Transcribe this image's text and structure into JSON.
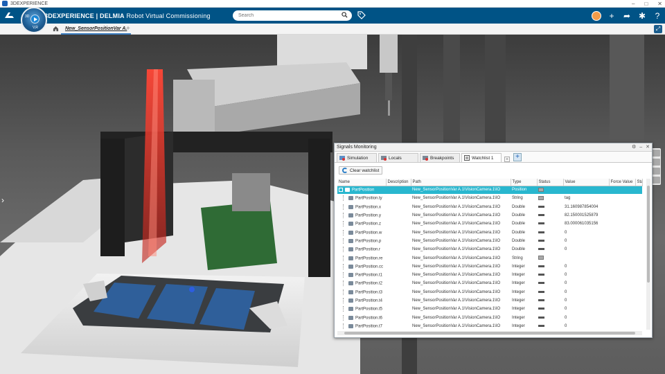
{
  "os_bar": {
    "title": "3DEXPERIENCE",
    "controls": [
      "–",
      "□",
      "✕"
    ]
  },
  "top_bar": {
    "brand_bold": "3DEXPERIENCE | DELMIA",
    "brand_rest": "Robot Virtual Commissioning",
    "search_placeholder": "Search"
  },
  "compass": {
    "top_label": "3D",
    "bottom_label": "V,R"
  },
  "tab_bar": {
    "document_tab": "New_SensorPositionVar A.",
    "add_tab": "+"
  },
  "panel": {
    "title": "Signals Monitoring",
    "tabs": [
      {
        "label": "Simulation"
      },
      {
        "label": "Locals"
      },
      {
        "label": "Breakpoints"
      },
      {
        "label": "Watchlist 1"
      }
    ],
    "clear_watchlist": "Clear watchlist",
    "columns": [
      "Name",
      "Description",
      "Path",
      "Type",
      "Status",
      "Value",
      "Force Value",
      "Sta"
    ],
    "rows": [
      {
        "name": "PartPosition",
        "path": "New_SensorPositionVar A.1\\VisionCamera.1\\IO",
        "type": "Position",
        "value": ""
      },
      {
        "name": "PartPosition.ty",
        "path": "New_SensorPositionVar A.1\\VisionCamera.1\\IO",
        "type": "String",
        "value": "tag"
      },
      {
        "name": "PartPosition.x",
        "path": "New_SensorPositionVar A.1\\VisionCamera.1\\IO",
        "type": "Double",
        "value": "31.160987854004"
      },
      {
        "name": "PartPosition.y",
        "path": "New_SensorPositionVar A.1\\VisionCamera.1\\IO",
        "type": "Double",
        "value": "82.150001525879"
      },
      {
        "name": "PartPosition.z",
        "path": "New_SensorPositionVar A.1\\VisionCamera.1\\IO",
        "type": "Double",
        "value": "83.000061035156"
      },
      {
        "name": "PartPosition.w",
        "path": "New_SensorPositionVar A.1\\VisionCamera.1\\IO",
        "type": "Double",
        "value": "0"
      },
      {
        "name": "PartPosition.p",
        "path": "New_SensorPositionVar A.1\\VisionCamera.1\\IO",
        "type": "Double",
        "value": "0"
      },
      {
        "name": "PartPosition.r",
        "path": "New_SensorPositionVar A.1\\VisionCamera.1\\IO",
        "type": "Double",
        "value": "0"
      },
      {
        "name": "PartPosition.re",
        "path": "New_SensorPositionVar A.1\\VisionCamera.1\\IO",
        "type": "String",
        "value": ""
      },
      {
        "name": "PartPosition.cc",
        "path": "New_SensorPositionVar A.1\\VisionCamera.1\\IO",
        "type": "Integer",
        "value": "0"
      },
      {
        "name": "PartPosition.t1",
        "path": "New_SensorPositionVar A.1\\VisionCamera.1\\IO",
        "type": "Integer",
        "value": "0"
      },
      {
        "name": "PartPosition.t2",
        "path": "New_SensorPositionVar A.1\\VisionCamera.1\\IO",
        "type": "Integer",
        "value": "0"
      },
      {
        "name": "PartPosition.t3",
        "path": "New_SensorPositionVar A.1\\VisionCamera.1\\IO",
        "type": "Integer",
        "value": "0"
      },
      {
        "name": "PartPosition.t4",
        "path": "New_SensorPositionVar A.1\\VisionCamera.1\\IO",
        "type": "Integer",
        "value": "0"
      },
      {
        "name": "PartPosition.t5",
        "path": "New_SensorPositionVar A.1\\VisionCamera.1\\IO",
        "type": "Integer",
        "value": "0"
      },
      {
        "name": "PartPosition.t6",
        "path": "New_SensorPositionVar A.1\\VisionCamera.1\\IO",
        "type": "Integer",
        "value": "0"
      },
      {
        "name": "PartPosition.t7",
        "path": "New_SensorPositionVar A.1\\VisionCamera.1\\IO",
        "type": "Integer",
        "value": "0"
      }
    ]
  },
  "colors": {
    "top_bar": "#005386",
    "selected_row": "#29b7cf",
    "laser": "#e0342b",
    "tray": "#2f5f9a"
  }
}
